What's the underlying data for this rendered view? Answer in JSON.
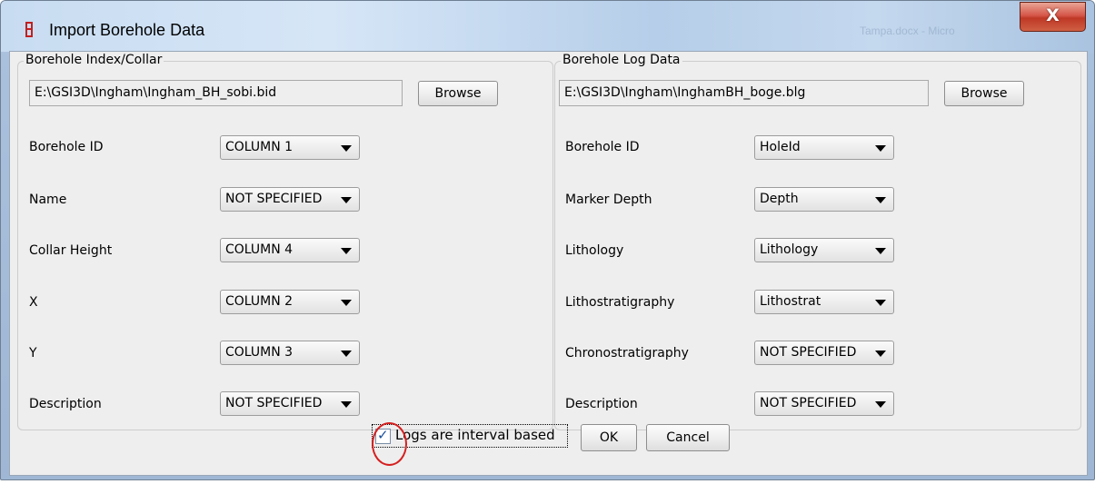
{
  "window": {
    "title": "Import Borehole Data",
    "ghost_title": "Tampa.docx - Micro",
    "close_symbol": "X"
  },
  "collar": {
    "group_label": "Borehole Index/Collar",
    "file_path": "E:\\GSI3D\\Ingham\\Ingham_BH_sobi.bid",
    "browse_label": "Browse",
    "fields": [
      {
        "label": "Borehole ID",
        "value": "COLUMN 1"
      },
      {
        "label": "Name",
        "value": "NOT SPECIFIED"
      },
      {
        "label": "Collar Height",
        "value": "COLUMN 4"
      },
      {
        "label": "X",
        "value": "COLUMN 2"
      },
      {
        "label": "Y",
        "value": "COLUMN 3"
      },
      {
        "label": "Description",
        "value": "NOT SPECIFIED"
      }
    ]
  },
  "log": {
    "group_label": "Borehole Log Data",
    "file_path": "E:\\GSI3D\\Ingham\\InghamBH_boge.blg",
    "browse_label": "Browse",
    "fields": [
      {
        "label": "Borehole ID",
        "value": "HoleId"
      },
      {
        "label": "Marker Depth",
        "value": "Depth"
      },
      {
        "label": "Lithology",
        "value": "Lithology"
      },
      {
        "label": "Lithostratigraphy",
        "value": "Lithostrat"
      },
      {
        "label": "Chronostratigraphy",
        "value": "NOT SPECIFIED"
      },
      {
        "label": "Description",
        "value": "NOT SPECIFIED"
      }
    ]
  },
  "footer": {
    "checkbox_label": "Logs are interval based",
    "checkbox_checked": true,
    "checkbox_mark": "✓",
    "ok_label": "OK",
    "cancel_label": "Cancel"
  },
  "colors": {
    "annotation_circle": "#d52020",
    "close_button": "#c8402c"
  },
  "icons": {
    "title": "borehole-app-icon",
    "close": "close-icon",
    "dropdown": "chevron-down-icon",
    "check": "checkmark-icon"
  }
}
